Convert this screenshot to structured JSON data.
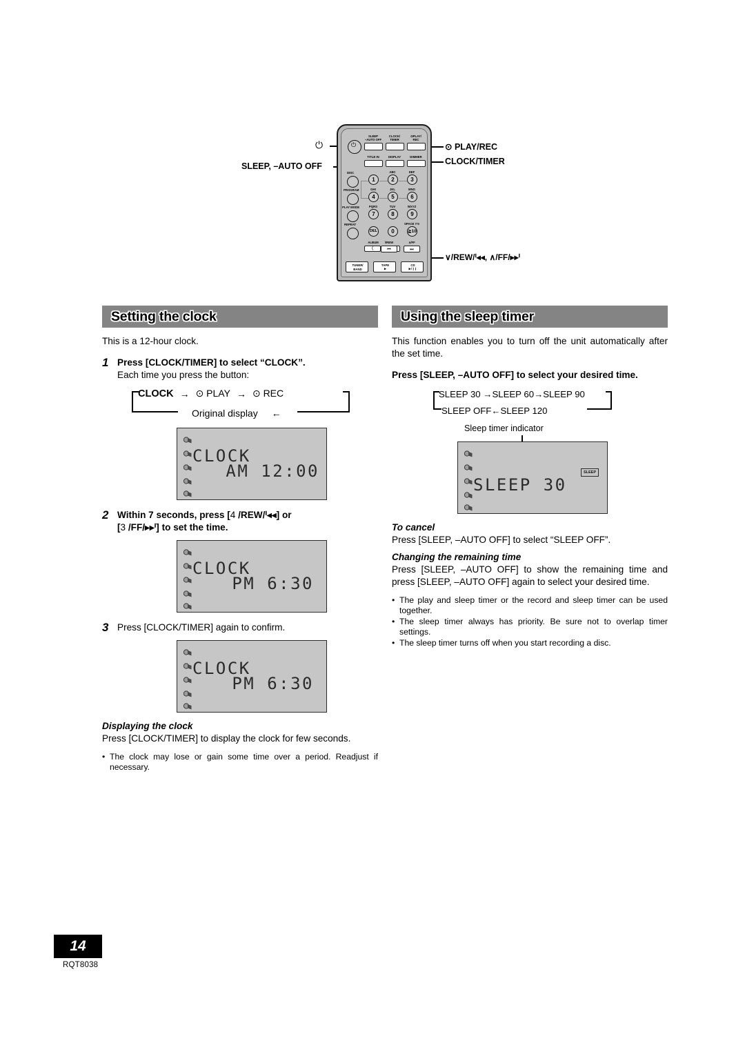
{
  "page": {
    "number": "14",
    "part_number": "RQT8038",
    "background_color": "#ffffff",
    "header_bar_color": "#848484",
    "lcd_color": "#c6c6c6"
  },
  "remote": {
    "top_row": [
      {
        "label_line1": "SLEEP",
        "label_line2": "–AUTO OFF"
      },
      {
        "label_line1": "CLOCK/",
        "label_line2": "TIMER"
      },
      {
        "label_line1": "⊙PLAY/",
        "label_line2": "REC"
      }
    ],
    "second_row": [
      "TITLE IN",
      "DISPLAY",
      "DIMMER"
    ],
    "left_column": [
      "DISC",
      "PROGRAM",
      "PLAY MODE",
      "REPEAT"
    ],
    "keypad": [
      {
        "key": "1",
        "sub": ""
      },
      {
        "key": "2",
        "sub": "ABC"
      },
      {
        "key": "3",
        "sub": "DEF"
      },
      {
        "key": "4",
        "sub": "GHI"
      },
      {
        "key": "5",
        "sub": "JKL"
      },
      {
        "key": "6",
        "sub": "MNO"
      },
      {
        "key": "7",
        "sub": "PQRS"
      },
      {
        "key": "8",
        "sub": "TUV"
      },
      {
        "key": "9",
        "sub": "WXYZ"
      },
      {
        "key": "DEL",
        "sub": ""
      },
      {
        "key": "0",
        "sub": ""
      },
      {
        "key": "≧10",
        "sub": "SPACE !?¤"
      }
    ],
    "album_label": "ALBUM",
    "album_keys": [
      "❰",
      "❱"
    ],
    "nav": [
      {
        "label": "\\/REW",
        "glyph": "ᑊ◂◂"
      },
      {
        "label": "∧/FF",
        "glyph": "▸▸ᑊ"
      }
    ],
    "bottom_row": [
      {
        "line1": "TUNER/",
        "line2": "BAND"
      },
      {
        "line1": "TAPE",
        "line2": "▶"
      },
      {
        "line1": "CD",
        "line2": "▶/❙❙"
      }
    ],
    "callouts": {
      "power": "⏻",
      "sleep_auto_off": "SLEEP, –AUTO OFF",
      "play_rec": "⊙ PLAY/REC",
      "clock_timer": "CLOCK/TIMER",
      "rew_ff": "∨/REW/ᑊ◂◂,  ∧/FF/▸▸ᑊ"
    }
  },
  "left_column": {
    "section_title": "Setting the clock",
    "intro": "This is a 12-hour clock.",
    "steps": [
      {
        "num": "1",
        "heading": "Press [CLOCK/TIMER] to select “CLOCK”.",
        "sub": "Each time you press the button:"
      },
      {
        "num": "2",
        "heading_part1": "Within 7 seconds, press [",
        "heading_key1": "4",
        "heading_part2": " /REW/ᑊ◂◂] or",
        "heading_part3": "[",
        "heading_key2": "3",
        "heading_part4": " /FF/▸▸ᑊ] to set the time."
      },
      {
        "num": "3",
        "heading": "Press [CLOCK/TIMER] again to confirm."
      }
    ],
    "cycle": {
      "item1": "CLOCK",
      "arrow1": "→",
      "item2": "⊙ PLAY",
      "arrow2": "→",
      "item3": "⊙ REC",
      "return_label": "Original display",
      "return_arrow": "←"
    },
    "lcd_1": {
      "line1": "CLOCK",
      "line2": "AM 12:00"
    },
    "lcd_2": {
      "line1": "CLOCK",
      "line2": "PM 6:30"
    },
    "lcd_3": {
      "line1": "CLOCK",
      "line2": "PM 6:30"
    },
    "displaying_head": "Displaying the clock",
    "displaying_text": "Press [CLOCK/TIMER] to display the clock for few seconds.",
    "bullets": [
      "The clock may lose or gain some time over a period. Readjust if necessary."
    ]
  },
  "right_column": {
    "section_title": "Using the sleep timer",
    "intro": "This function enables you to turn off the unit automatically after the set time.",
    "instruction": "Press [SLEEP, –AUTO OFF] to select your desired time.",
    "sleep_cycle": {
      "row1": "SLEEP 30 →SLEEP 60→SLEEP 90",
      "row2": "SLEEP OFF←SLEEP 120"
    },
    "indicator_caption": "Sleep timer indicator",
    "lcd": {
      "line1": "SLEEP  30",
      "indicator_label": "SLEEP"
    },
    "to_cancel_head": "To cancel",
    "to_cancel_text": "Press [SLEEP, –AUTO OFF] to select “SLEEP OFF”.",
    "changing_head": "Changing the remaining time",
    "changing_text": "Press [SLEEP, –AUTO OFF] to show the remaining time and press [SLEEP, –AUTO OFF] again to select your desired time.",
    "bullets": [
      "The play and sleep timer or the record and sleep timer can be used together.",
      "The sleep timer always has priority. Be sure not to overlap timer settings.",
      "The sleep timer turns off when you start recording a disc."
    ]
  }
}
